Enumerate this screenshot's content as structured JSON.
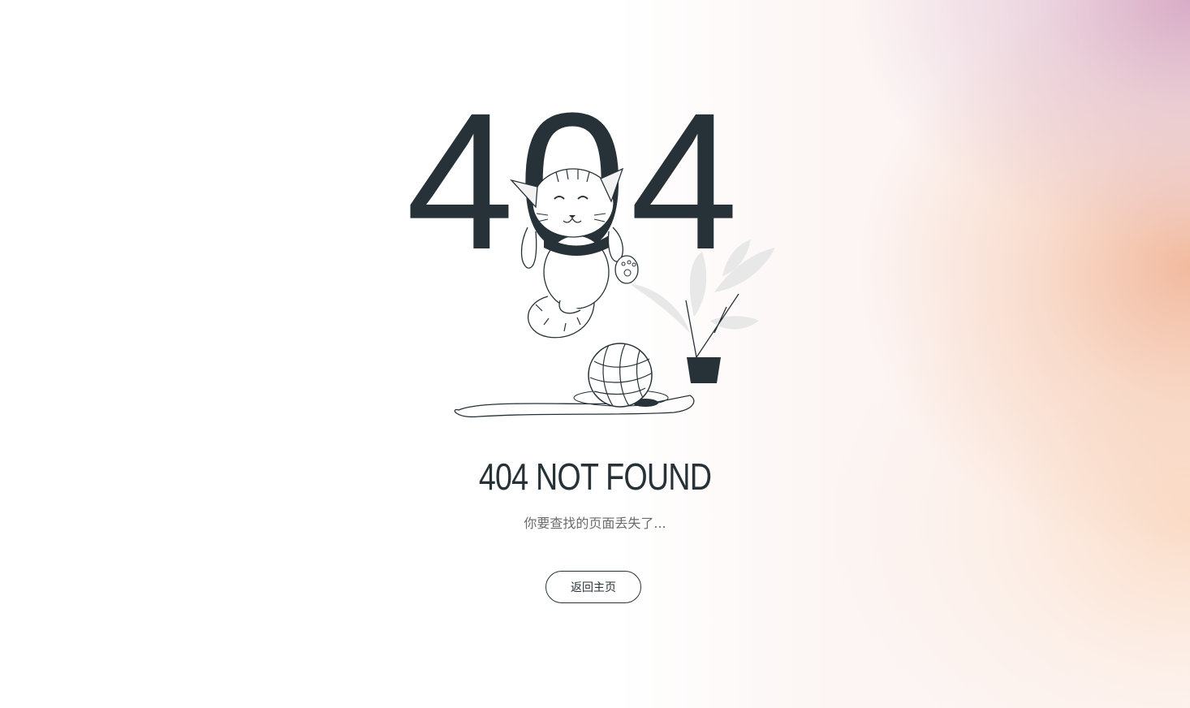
{
  "illustration": {
    "digits": [
      "4",
      "0",
      "4"
    ],
    "dark_color": "#263238",
    "leaf_color": "#e6e6e6",
    "elements": [
      "cat-icon",
      "yarn-ball-icon",
      "potted-plant-icon"
    ]
  },
  "title": "404 NOT FOUND",
  "subtitle": "你要查找的页面丢失了...",
  "home_button": {
    "label": "返回主页"
  }
}
